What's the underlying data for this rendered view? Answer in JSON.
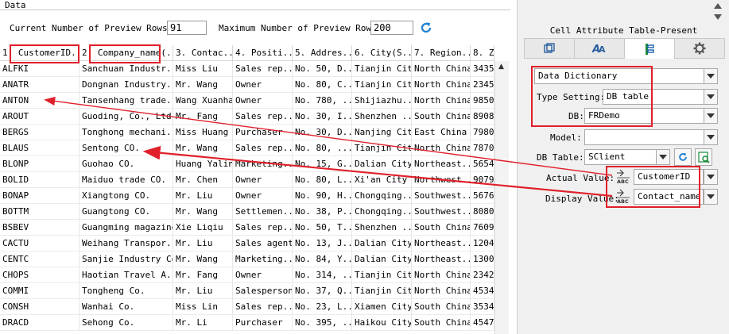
{
  "data_panel": {
    "title": "Data",
    "current_rows_label": "Current Number of  Preview Rows:",
    "current_rows_value": "91",
    "max_rows_label": "Maximum Number of Preview Rows:",
    "max_rows_value": "200"
  },
  "table": {
    "headers": [
      "1. CustomerID...",
      "2. Company_name(...",
      "3. Contac...",
      "4. Positi...",
      "5. Addres...",
      "6. City(S...",
      "7. Region...",
      "8. Z"
    ],
    "rows": [
      [
        "ALFKI",
        "Sanchuan Industr...",
        "Miss Liu",
        "Sales rep...",
        "No. 50, D...",
        "Tianjin City",
        "North China",
        "3435"
      ],
      [
        "ANATR",
        "Dongnan Industry...",
        "Mr. Wang",
        "Owner",
        "No. 80, C...",
        "Tianjin City",
        "North China",
        "2345"
      ],
      [
        "ANTON",
        "Tansenhang trade...",
        "Wang Xuanhao",
        "Owner",
        "No. 780, ...",
        "Shijiazhu...",
        "North China",
        "9850"
      ],
      [
        "AROUT",
        "Guoding, Co., Ltd.",
        "Mr. Fang",
        "Sales rep...",
        "No. 30, I...",
        "Shenzhen ...",
        "South China",
        "8908"
      ],
      [
        "BERGS",
        "Tonghong mechani...",
        "Miss Huang",
        "Purchaser",
        "No. 30, D...",
        "Nanjing City",
        "East China",
        "7980"
      ],
      [
        "BLAUS",
        "Sentong CO.",
        "Mr. Wang",
        "Sales rep...",
        "No. 80, ...",
        "Tianjin City",
        "North China",
        "7870"
      ],
      [
        "BLONP",
        "Guohao CO.",
        "Huang Yaling",
        "Marketing...",
        "No. 15, G...",
        "Dalian City",
        "Northeast...",
        "5654"
      ],
      [
        "BOLID",
        "Maiduo trade CO.",
        "Mr. Chen",
        "Owner",
        "No. 80, L...",
        "Xi'an City",
        "Northwest...",
        "9079"
      ],
      [
        "BONAP",
        "Xiangtong CO.",
        "Mr. Liu",
        "Owner",
        "No. 90, H...",
        "Chongqing...",
        "Southwest...",
        "5676"
      ],
      [
        "BOTTM",
        "Guangtong CO.",
        "Mr. Wang",
        "Settlemen...",
        "No. 38, P...",
        "Chongqing...",
        "Southwest...",
        "8080"
      ],
      [
        "BSBEV",
        "Guangming magazine",
        "Xie Liqiu",
        "Sales rep...",
        "No. 50, T...",
        "Shenzhen ...",
        "South China",
        "7609"
      ],
      [
        "CACTU",
        "Weihang Transpor...",
        "Mr. Liu",
        "Sales agent",
        "No. 13, J...",
        "Dalian City",
        "Northeast...",
        "1204"
      ],
      [
        "CENTC",
        "Sanjie Industry Co.",
        "Mr. Wang",
        "Marketing...",
        "No. 84, Y...",
        "Dalian City",
        "Northeast...",
        "1300"
      ],
      [
        "CHOPS",
        "Haotian Travel A...",
        "Mr. Fang",
        "Owner",
        "No. 314, ...",
        "Tianjin City",
        "North China",
        "2342"
      ],
      [
        "COMMI",
        "Tongheng Co.",
        "Mr. Liu",
        "Salesperson",
        "No. 37, Q...",
        "Tianjin City",
        "North China",
        "4534"
      ],
      [
        "CONSH",
        "Wanhai Co.",
        "Miss Lin",
        "Sales rep...",
        "No. 23, L...",
        "Xiamen City",
        "South China",
        "3534"
      ],
      [
        "DRACD",
        "Sehong Co.",
        "Mr. Li",
        "Purchaser",
        "No. 395, ...",
        "Haikou City",
        "South China",
        "4547"
      ]
    ]
  },
  "attr_panel": {
    "title": "Cell Attribute Table-Present",
    "dict_select": "Data Dictionary",
    "type_label": "Type Setting:",
    "type_value": "DB table",
    "db_label": "DB:",
    "db_value": "FRDemo",
    "model_label": "Model:",
    "model_value": "",
    "dbtable_label": "DB Table:",
    "dbtable_value": "SClient",
    "actual_label": "Actual Value:",
    "actual_value": "CustomerID",
    "display_label": "Display Value:",
    "display_value": "Contact_name",
    "abc_text": "ABC"
  },
  "colors": {
    "accent_red": "#e0202a",
    "refresh_blue": "#1f7fd0"
  },
  "icons": [
    "refresh-icon",
    "cell-element-icon",
    "font-style-icon",
    "present-icon",
    "gear-icon",
    "chevron-down-icon",
    "formula-icon",
    "abc-field-icon"
  ]
}
